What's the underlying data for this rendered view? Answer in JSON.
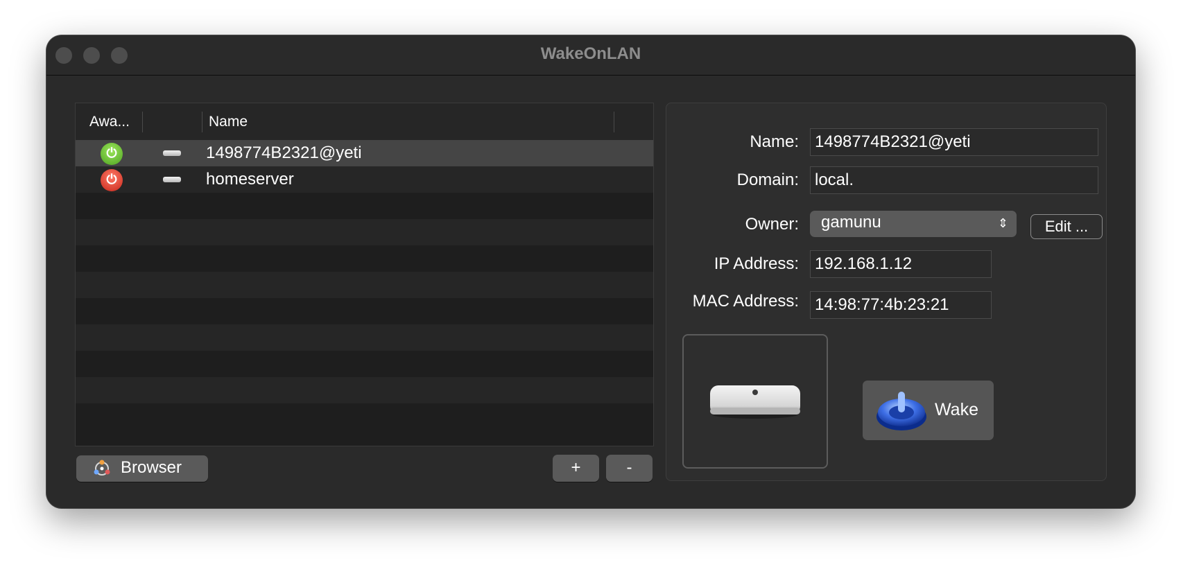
{
  "window": {
    "title": "WakeOnLAN"
  },
  "table": {
    "columns": [
      "Awa...",
      "",
      "Name"
    ],
    "rows": [
      {
        "status": "awake",
        "status_color": "#5dbb2c",
        "name": "1498774B2321@yeti",
        "selected": true
      },
      {
        "status": "asleep",
        "status_color": "#de3a2c",
        "name": "homeserver",
        "selected": false
      }
    ]
  },
  "buttons": {
    "browser_label": "Browser",
    "add_label": "+",
    "remove_label": "-",
    "edit_label": "Edit ...",
    "wake_label": "Wake"
  },
  "detail": {
    "name_label": "Name:",
    "name_value": "1498774B2321@yeti",
    "domain_label": "Domain:",
    "domain_value": "local.",
    "owner_label": "Owner:",
    "owner_value": "gamunu",
    "ip_label": "IP Address:",
    "ip_value": "192.168.1.12",
    "mac_label": "MAC Address:",
    "mac_value": "14:98:77:4b:23:21"
  },
  "icons": {
    "power_glyph": "⏻",
    "select_chevron": "⌃⌄",
    "device": "mac-mini-icon",
    "wake": "power-button-icon",
    "browser": "network-browser-icon"
  }
}
